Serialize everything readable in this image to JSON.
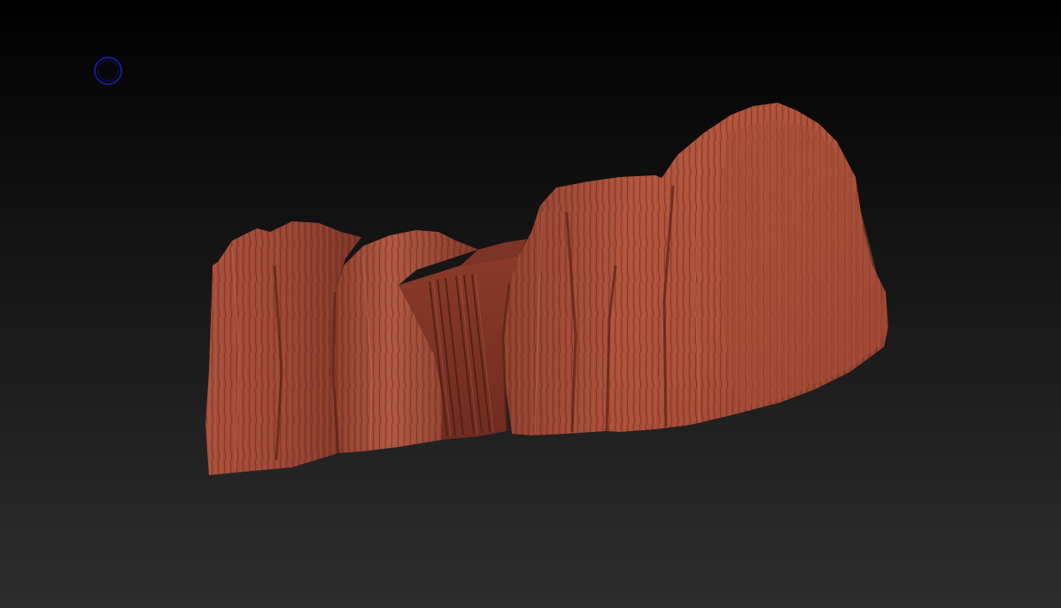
{
  "viewport": {
    "background_top": "#000000",
    "background_bottom": "#2c2c2c"
  },
  "brush": {
    "icon": "brush-circle-icon",
    "color": "#1a1a8c"
  },
  "model": {
    "material_color": "#9c4634",
    "highlight_color": "#c2634c",
    "shadow_color": "#5a2217"
  }
}
